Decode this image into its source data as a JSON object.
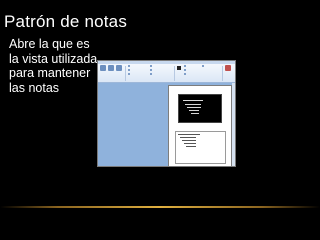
{
  "slide": {
    "title": "Patrón de notas",
    "body": "Abre la que es la vista utilizada para mantener las notas"
  },
  "colors": {
    "background": "#000000",
    "text": "#ffffff",
    "accent_line": "#e0b040",
    "workspace": "#8fb2dc"
  }
}
